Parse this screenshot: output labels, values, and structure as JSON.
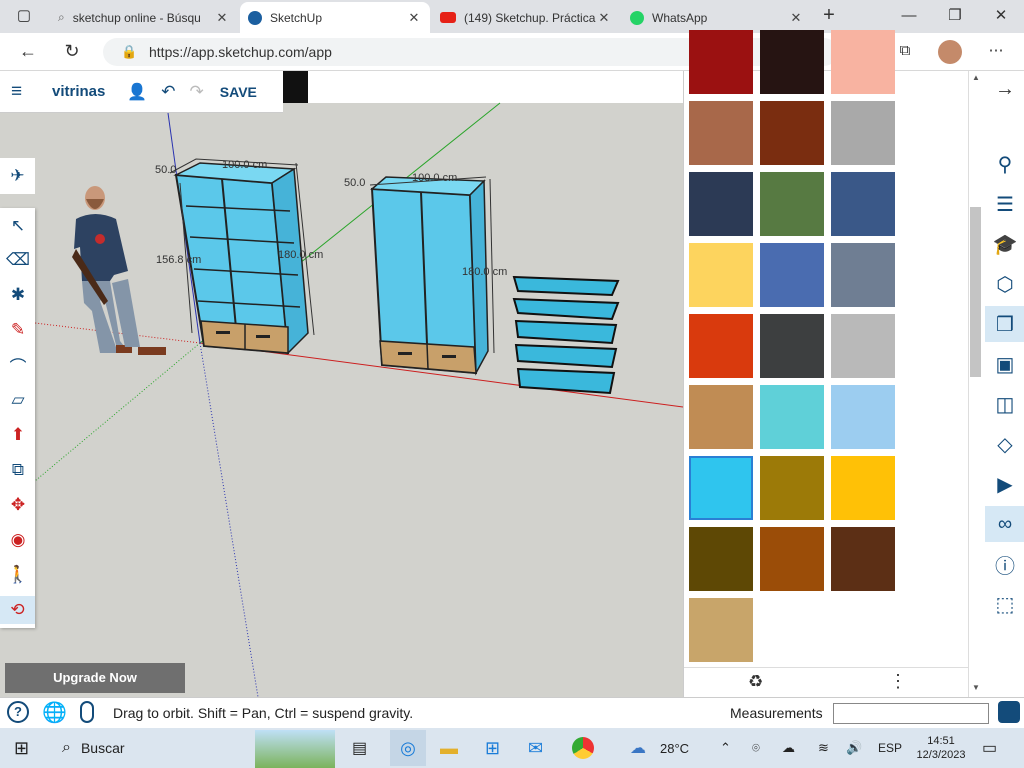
{
  "browser": {
    "tabs": [
      {
        "label": "sketchup online - Búsqu",
        "active": false
      },
      {
        "label": "SketchUp",
        "active": true
      },
      {
        "label": "(149) Sketchup. Práctica",
        "active": false
      },
      {
        "label": "WhatsApp",
        "active": false
      }
    ],
    "url": "https://app.sketchup.com/app"
  },
  "app": {
    "title": "vitrinas",
    "save_label": "SAVE",
    "upgrade_label": "Upgrade Now",
    "status_text": "Drag to orbit. Shift = Pan, Ctrl = suspend gravity.",
    "measurements_label": "Measurements",
    "measurements_value": ""
  },
  "dimensions": {
    "cab1_depth": "50.0",
    "cab1_width": "100.0 cm",
    "cab1_height": "156.8 cm",
    "cab1_side": "180.0 cm",
    "cab2_depth": "50.0",
    "cab2_width": "100.0 cm",
    "cab2_height": "180.0 cm"
  },
  "materials": [
    "#9b1111",
    "#261412",
    "#f8b3a1",
    "#a8684a",
    "#7a2d10",
    "#a9a9a9",
    "#2c3a55",
    "#577a42",
    "#3a5888",
    "#fdd45e",
    "#4a6cb0",
    "#6f7e93",
    "#d93a0d",
    "#3d3f40",
    "#b9b9b9",
    "#c08c54",
    "#5fd0d8",
    "#9ccdf0",
    "#2fc5ee",
    "#9c7a08",
    "#ffc106",
    "#5e4805",
    "#9b4d08",
    "#5c2f15",
    "#c8a56a"
  ],
  "taskbar": {
    "search_label": "Buscar",
    "weather": "28°C",
    "language": "ESP",
    "time": "14:51",
    "date": "12/3/2023"
  }
}
